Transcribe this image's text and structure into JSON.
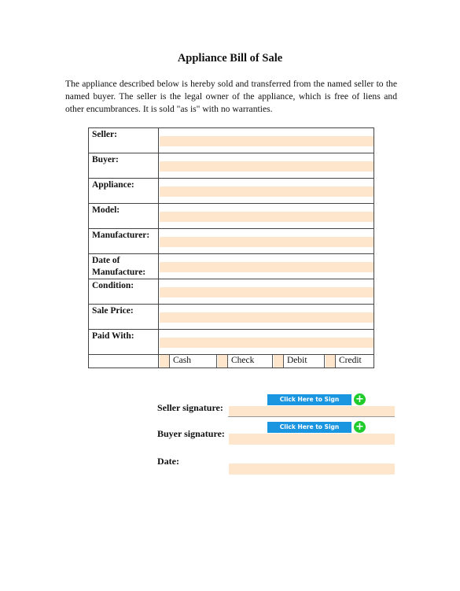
{
  "document": {
    "title": "Appliance Bill of Sale",
    "intro": "The appliance described below is hereby sold and transferred from the named seller to the named buyer. The seller is the legal owner of the appliance, which is free of liens and other encumbrances. It is sold \"as is\" with no warranties."
  },
  "form": {
    "fields": [
      {
        "label": "Seller:",
        "value": ""
      },
      {
        "label": "Buyer:",
        "value": ""
      },
      {
        "label": "Appliance:",
        "value": ""
      },
      {
        "label": "Model:",
        "value": ""
      },
      {
        "label": "Manufacturer:",
        "value": ""
      },
      {
        "label": "Date of Manufacture:",
        "value": ""
      },
      {
        "label": "Condition:",
        "value": ""
      },
      {
        "label": "Sale Price:",
        "value": ""
      },
      {
        "label": "Paid With:",
        "value": ""
      }
    ],
    "payment_options": [
      "Cash",
      "Check",
      "Debit",
      "Credit"
    ]
  },
  "signatures": {
    "seller_label": "Seller signature:",
    "buyer_label": "Buyer signature:",
    "date_label": "Date:",
    "sign_button_label": "Click Here to Sign",
    "add_icon": "+"
  },
  "colors": {
    "field_fill": "#fde6cc",
    "sign_button": "#1a95e0",
    "add_icon": "#1fcc2c"
  }
}
